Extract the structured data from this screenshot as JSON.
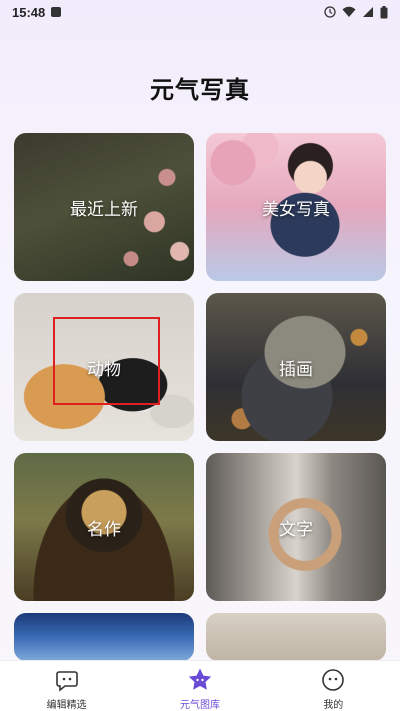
{
  "status_bar": {
    "time": "15:48",
    "icons": [
      "notification-icon",
      "clock-icon",
      "wifi-icon",
      "signal-icon",
      "battery-icon"
    ]
  },
  "page": {
    "title": "元气写真"
  },
  "categories": [
    {
      "label": "最近上新",
      "image": "rose-garden"
    },
    {
      "label": "美女写真",
      "image": "girl-in-sailor-uniform"
    },
    {
      "label": "动物",
      "image": "cats"
    },
    {
      "label": "插画",
      "image": "hooded-character-illustration"
    },
    {
      "label": "名作",
      "image": "mona-lisa"
    },
    {
      "label": "文字",
      "image": "tiktok-logo-sculpture"
    },
    {
      "label": "",
      "image": "blue-skyscraper"
    },
    {
      "label": "",
      "image": "open-book"
    }
  ],
  "tabbar": {
    "items": [
      {
        "label": "编辑精选",
        "icon": "chat-bubble-face-icon",
        "active": false
      },
      {
        "label": "元气图库",
        "icon": "star-face-icon",
        "active": true
      },
      {
        "label": "我的",
        "icon": "smiley-face-icon",
        "active": false
      }
    ]
  },
  "colors": {
    "accent": "#6a4bd6",
    "highlight_box": "#e02020",
    "background": "#f4f1fb"
  }
}
